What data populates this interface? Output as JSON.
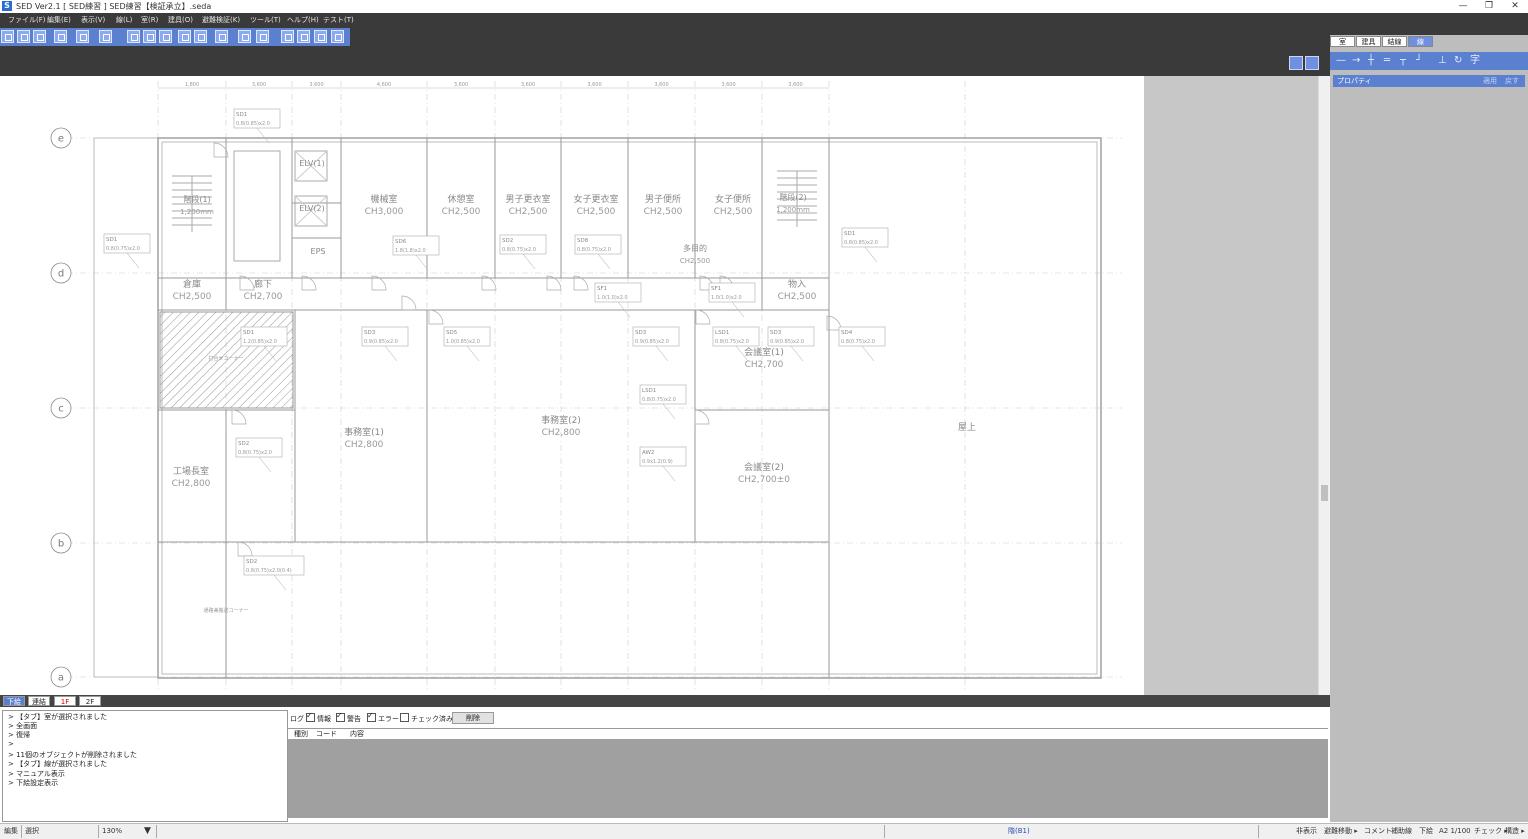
{
  "window": {
    "title": "SED Ver2.1 [ SED練習 ] SED練習【検証承立】.seda",
    "app_icon": "S",
    "minimize": "—",
    "maximize": "❐",
    "close": "✕"
  },
  "menu": [
    "ファイル(F)",
    "編集(E)",
    "表示(V)",
    "線(L)",
    "室(R)",
    "建具(O)",
    "避難検証(K)",
    "ツール(T)",
    "ヘルプ(H)",
    "テスト(T)"
  ],
  "right_panel": {
    "tabs": [
      "室",
      "建具",
      "結線",
      "線"
    ],
    "active_tab": "線",
    "properties_label": "プロパティ",
    "properties_btn_a": "適用",
    "properties_btn_b": "戻す"
  },
  "plan": {
    "top_dims": [
      "1,800",
      "3,600",
      "3,600",
      "4,600",
      "3,600",
      "3,600",
      "3,600",
      "3,600",
      "3,600",
      "3,600"
    ],
    "grid_labels": [
      "e",
      "d",
      "c",
      "b",
      "a"
    ],
    "rooms": [
      {
        "name": "階段(1)",
        "sub": "1,200mm"
      },
      {
        "name": "機械室",
        "sub": "CH3,000"
      },
      {
        "name": "休憩室",
        "sub": "CH2,500"
      },
      {
        "name": "男子更衣室",
        "sub": "CH2,500"
      },
      {
        "name": "女子更衣室",
        "sub": "CH2,500"
      },
      {
        "name": "男子便所",
        "sub": "CH2,500"
      },
      {
        "name": "女子便所",
        "sub": "CH2,500"
      },
      {
        "name": "階段(2)",
        "sub": "1,200mm"
      },
      {
        "name": "倉庫",
        "sub": "CH2,500"
      },
      {
        "name": "廊下",
        "sub": "CH2,700"
      },
      {
        "name": "物入",
        "sub": "CH2,500"
      },
      {
        "name": "会議室(1)",
        "sub": "CH2,700"
      },
      {
        "name": "事務室(2)",
        "sub": "CH2,800"
      },
      {
        "name": "事務室(1)",
        "sub": "CH2,800"
      },
      {
        "name": "工場長室",
        "sub": "CH2,800"
      },
      {
        "name": "会議室(2)",
        "sub": "CH2,700±0"
      },
      {
        "name": "屋上",
        "sub": ""
      },
      {
        "name": "EPS",
        "sub": ""
      },
      {
        "name": "ELV(1)",
        "sub": ""
      },
      {
        "name": "ELV(2)",
        "sub": ""
      },
      {
        "name": "多目的",
        "sub": "CH2,500"
      }
    ],
    "doors": [
      {
        "code": "SD1",
        "spec": "0.8(0.85)x2.0"
      },
      {
        "code": "SD1",
        "spec": "0.8(0.75)x2.0"
      },
      {
        "code": "SD6",
        "spec": "1.8(1.8)x2.0"
      },
      {
        "code": "SD2",
        "spec": "0.8(0.75)x2.0"
      },
      {
        "code": "SD8",
        "spec": "0.8(0.75)x2.0"
      },
      {
        "code": "SD1",
        "spec": "0.8(0.85)x2.0"
      },
      {
        "code": "SF1",
        "spec": "1.0(1.0)x2.0"
      },
      {
        "code": "SF1",
        "spec": "1.0(1.0)x2.0"
      },
      {
        "code": "SD1",
        "spec": "1.2(0.85)x2.0"
      },
      {
        "code": "SD3",
        "spec": "0.9(0.85)x2.0"
      },
      {
        "code": "SD5",
        "spec": "1.0(0.85)x2.0"
      },
      {
        "code": "SD3",
        "spec": "0.9(0.85)x2.0"
      },
      {
        "code": "LSD1",
        "spec": "0.8(0.75)x2.0"
      },
      {
        "code": "SD3",
        "spec": "0.9(0.85)x2.0"
      },
      {
        "code": "SD4",
        "spec": "0.8(0.75)x2.0"
      },
      {
        "code": "LSD1",
        "spec": "0.8(0.75)x2.0"
      },
      {
        "code": "SD2",
        "spec": "0.8(0.75)x2.0"
      },
      {
        "code": "AW2",
        "spec": "0.9x1.2(0.9)"
      },
      {
        "code": "SD2",
        "spec": "0.8(0.75)x2.0(0.4)"
      }
    ],
    "hatched_label": "打合せコーナー",
    "lower_label": "通路兼搬送コーナー"
  },
  "floor_tabs": [
    "下絵",
    "連結",
    "1F",
    "2F"
  ],
  "console_lines": [
    "> 【タブ】室が選択されました",
    "> 全画面",
    "> 復帰",
    ">",
    "> 11個のオブジェクトが削除されました",
    "> 【タブ】線が選択されました",
    "> マニュアル表示",
    "> 下絵設定表示"
  ],
  "log": {
    "label": "ログ",
    "filters": [
      {
        "label": "情報",
        "checked": true
      },
      {
        "label": "警告",
        "checked": true
      },
      {
        "label": "エラー",
        "checked": true
      },
      {
        "label": "チェック済み",
        "checked": false
      }
    ],
    "clear_button": "削除",
    "columns": [
      "種別",
      "コード",
      "内容"
    ]
  },
  "status": {
    "mode": "編集",
    "tool": "選択",
    "zoom": "130%",
    "floor": "階(B1)",
    "right_items": [
      "非表示",
      "避難移動 ▸",
      "コメント",
      "補助線",
      "下絵",
      "A2 1/100",
      "チェック ▸",
      "構造 ▸"
    ]
  }
}
